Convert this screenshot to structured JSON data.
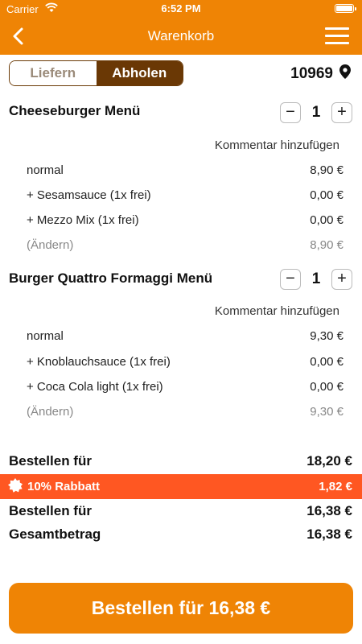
{
  "status": {
    "carrier": "Carrier",
    "time": "6:52 PM"
  },
  "nav": {
    "title": "Warenkorb"
  },
  "delivery": {
    "options": [
      "Liefern",
      "Abholen"
    ],
    "selected": "Abholen",
    "zip": "10969"
  },
  "items": [
    {
      "name": "Cheeseburger Menü",
      "quantity": "1",
      "comment": "Kommentar hinzufügen",
      "lines": [
        {
          "label": "normal",
          "price": "8,90 €"
        },
        {
          "label": "+ Sesamsauce (1x frei)",
          "price": "0,00 €"
        },
        {
          "label": "+ Mezzo Mix (1x frei)",
          "price": "0,00 €"
        },
        {
          "label": "(Ändern)",
          "price": "8,90 €"
        }
      ]
    },
    {
      "name": "Burger Quattro Formaggi Menü",
      "quantity": "1",
      "comment": "Kommentar hinzufügen",
      "lines": [
        {
          "label": "normal",
          "price": "9,30 €"
        },
        {
          "label": "+ Knoblauchsauce (1x frei)",
          "price": "0,00 €"
        },
        {
          "label": "+ Coca Cola light (1x frei)",
          "price": "0,00 €"
        },
        {
          "label": "(Ändern)",
          "price": "9,30 €"
        }
      ]
    }
  ],
  "summary": {
    "subtotal_label": "Bestellen für",
    "subtotal_value": "18,20 €",
    "discount_label": "10% Rabbatt",
    "discount_value": "1,82 €",
    "after_discount_label": "Bestellen für",
    "after_discount_value": "16,38 €",
    "total_label": "Gesamtbetrag",
    "total_value": "16,38 €"
  },
  "cta": {
    "label": "Bestellen für 16,38 €"
  },
  "colors": {
    "brand": "#ef8405",
    "segment_active": "#6a3805",
    "discount": "#ff5722"
  },
  "icons": {
    "back": "chevron-left-icon",
    "menu": "hamburger-menu-icon",
    "location": "location-pin-icon",
    "discount": "badge-icon",
    "wifi": "wifi-icon",
    "battery": "battery-icon"
  }
}
